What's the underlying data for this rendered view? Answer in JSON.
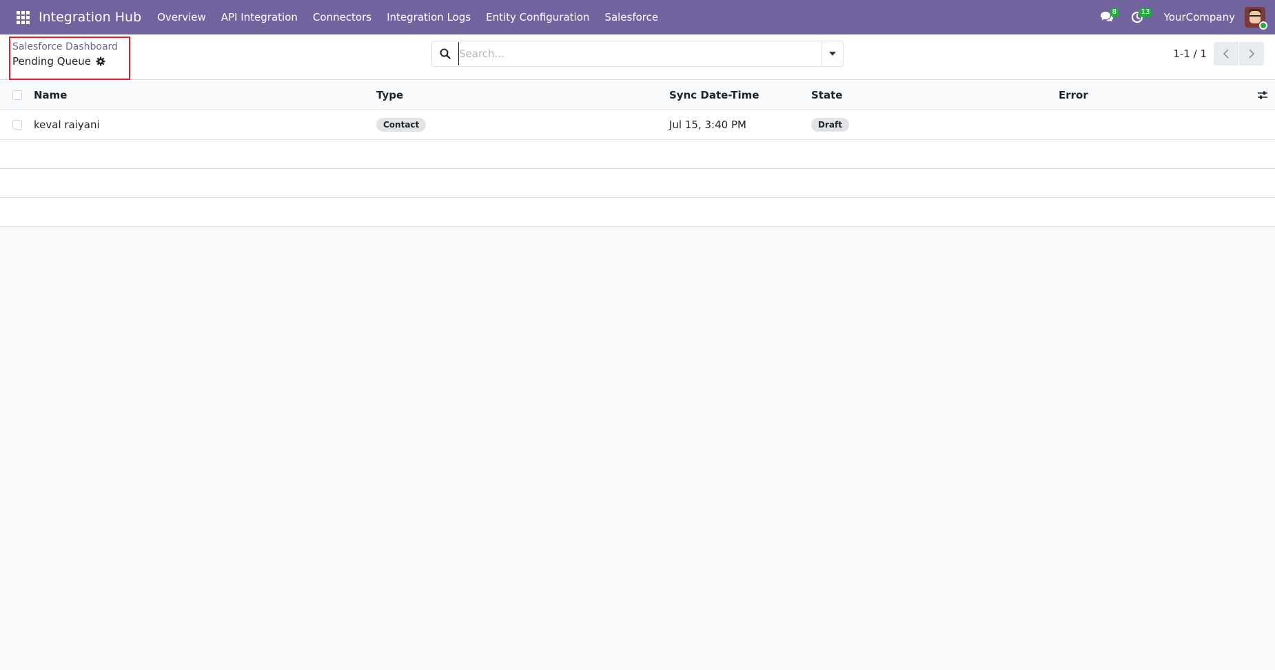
{
  "navbar": {
    "brand": "Integration Hub",
    "menu": [
      "Overview",
      "API Integration",
      "Connectors",
      "Integration Logs",
      "Entity Configuration",
      "Salesforce"
    ],
    "messages_count": "8",
    "activities_count": "13",
    "company": "YourCompany",
    "color": "#71639e"
  },
  "control_panel": {
    "breadcrumb": "Salesforce Dashboard",
    "title": "Pending Queue",
    "search_placeholder": "Search...",
    "pager": "1-1 / 1"
  },
  "list": {
    "columns": [
      "Name",
      "Type",
      "Sync Date-Time",
      "State",
      "Error"
    ],
    "rows": [
      {
        "name": "keval raiyani",
        "type": "Contact",
        "sync_datetime": "Jul 15, 3:40 PM",
        "state": "Draft",
        "error": ""
      }
    ]
  }
}
